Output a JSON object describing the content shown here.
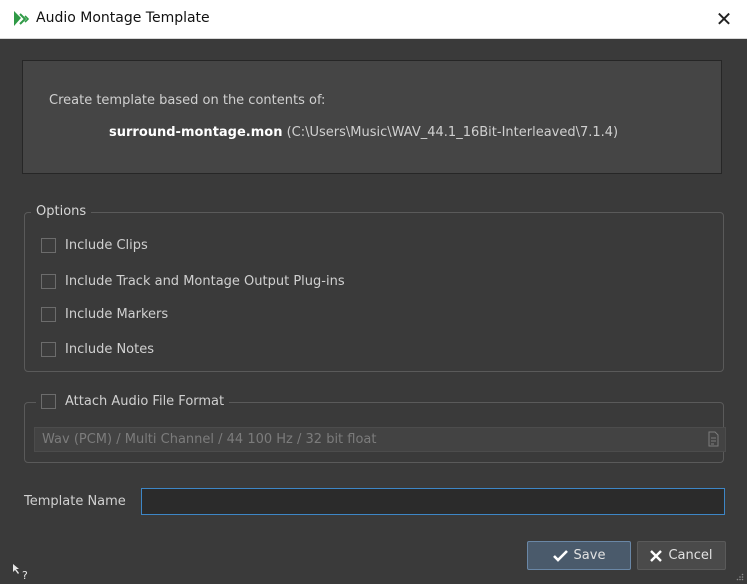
{
  "window": {
    "title": "Audio Montage Template",
    "close_glyph": "✕"
  },
  "info": {
    "line1": "Create template based on the contents of:",
    "filename": "surround-montage.mon",
    "path": " (C:\\Users\\Music\\WAV_44.1_16Bit-Interleaved\\7.1.4)"
  },
  "options": {
    "legend": "Options",
    "items": [
      {
        "label": "Include Clips",
        "checked": false
      },
      {
        "label": "Include Track and Montage Output Plug-ins",
        "checked": false
      },
      {
        "label": "Include Markers",
        "checked": false
      },
      {
        "label": "Include Notes",
        "checked": false
      }
    ]
  },
  "format": {
    "legend": "Attach Audio File Format",
    "checked": false,
    "value": "Wav (PCM) / Multi Channel / 44 100 Hz / 32 bit float",
    "icon": "file-format-icon"
  },
  "template_name": {
    "label": "Template Name",
    "value": ""
  },
  "buttons": {
    "save": "Save",
    "cancel": "Cancel"
  },
  "colors": {
    "background": "#3a3a3a",
    "accent": "#3d86c6",
    "logo_green": "#3aa84a"
  }
}
